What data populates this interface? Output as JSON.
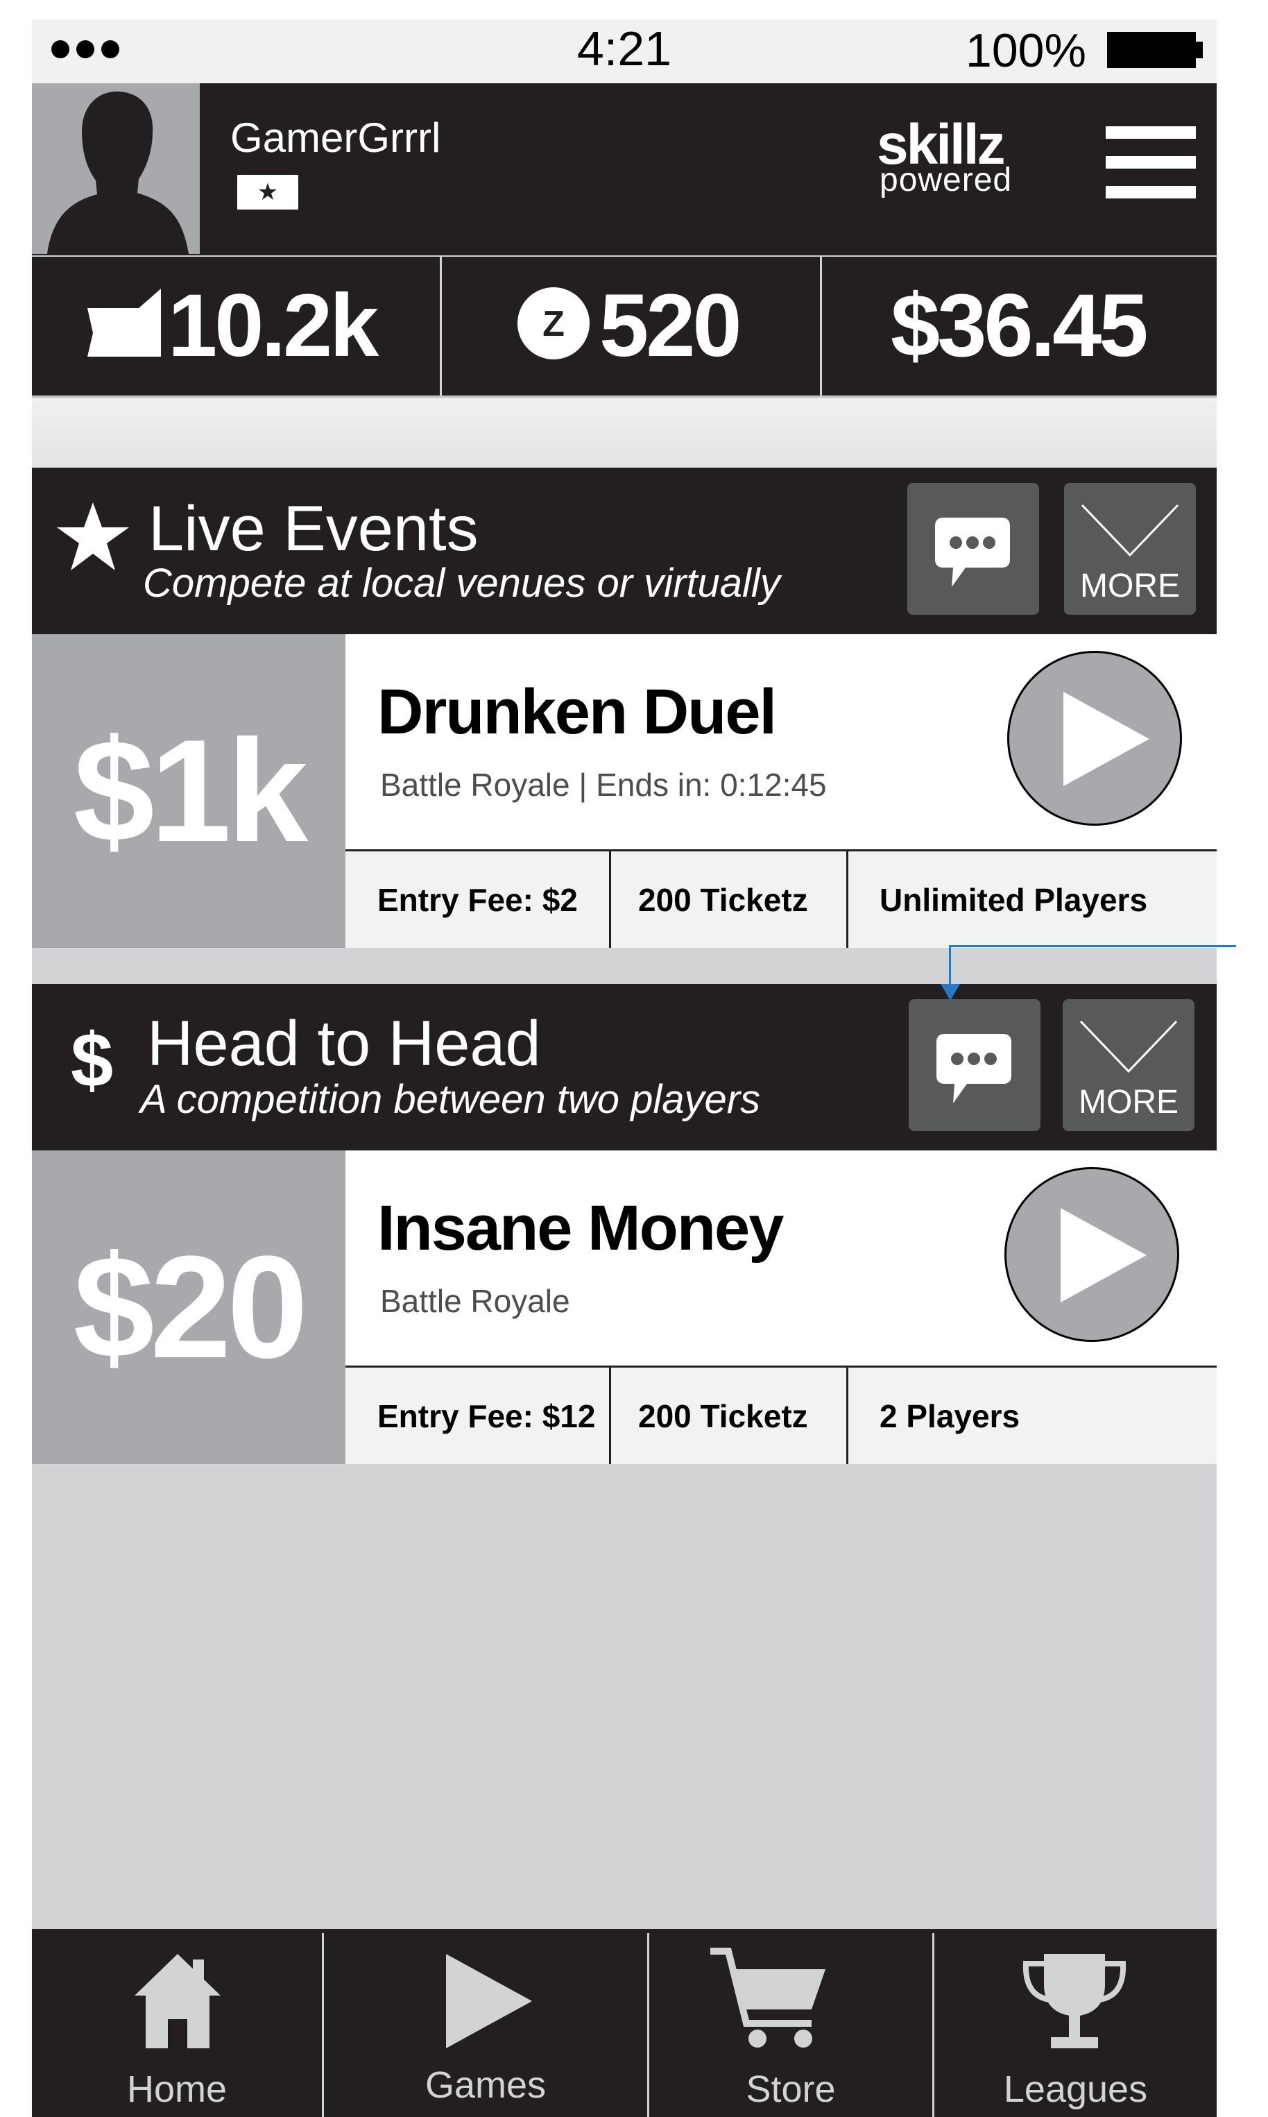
{
  "status_bar": {
    "time": "4:21",
    "battery": "100%"
  },
  "profile": {
    "username": "GamerGrrrl",
    "rank_badge": "★"
  },
  "brand": {
    "name": "skillz",
    "tagline": "powered"
  },
  "stats": {
    "tickets": "10.2k",
    "z_coins": "520",
    "z_symbol": "Z",
    "cash": "$36.45"
  },
  "live_events": {
    "title": "Live Events",
    "subtitle": "Compete at local venues or virtually",
    "more_label": "MORE",
    "event": {
      "prize": "$1k",
      "name": "Drunken Duel",
      "meta": "Battle Royale | Ends in: 0:12:45",
      "entry_fee": "Entry Fee: $2",
      "tickets": "200 Ticketz",
      "players": "Unlimited Players"
    }
  },
  "head_to_head": {
    "icon_text": "$",
    "title": "Head to Head",
    "subtitle": "A competition between two players",
    "more_label": "MORE",
    "event": {
      "prize": "$20",
      "name": "Insane Money",
      "meta": "Battle Royale",
      "entry_fee": "Entry Fee: $12",
      "tickets": "200 Ticketz",
      "players": "2 Players"
    }
  },
  "nav": [
    {
      "label": "Home",
      "icon": "home-icon"
    },
    {
      "label": "Games",
      "icon": "play-icon"
    },
    {
      "label": "Store",
      "icon": "cart-icon"
    },
    {
      "label": "Leagues",
      "icon": "trophy-icon"
    }
  ],
  "colors": {
    "dark": "#231f20",
    "gray": "#a7a9ac",
    "button_gray": "#58595b",
    "background": "#d2d3d5",
    "annotation": "#2b78be"
  }
}
